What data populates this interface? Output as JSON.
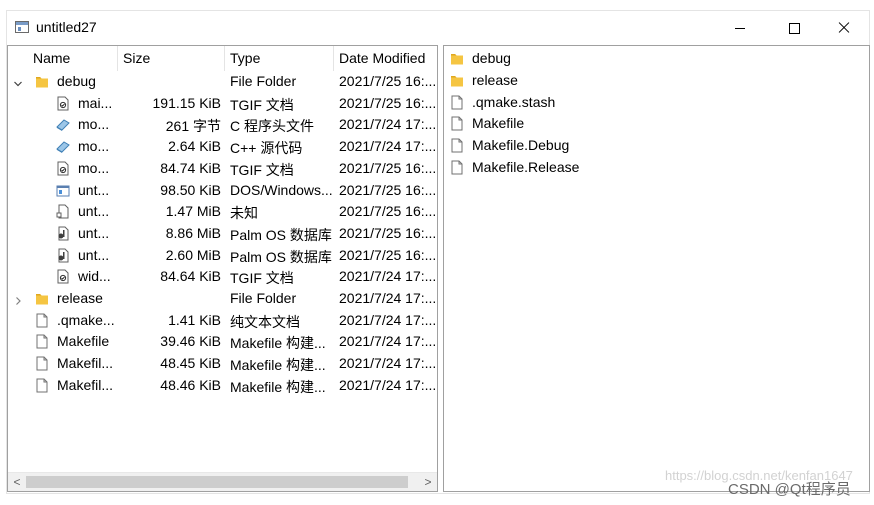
{
  "window": {
    "title": "untitled27"
  },
  "tree": {
    "columns": [
      "Name",
      "Size",
      "Type",
      "Date Modified"
    ],
    "rows": [
      {
        "name": "debug",
        "size": "",
        "type": "File Folder",
        "date": "2021/7/25 16:...",
        "kind": "folder",
        "depth": 0,
        "expander": "expanded",
        "icon": "folder-icon"
      },
      {
        "name": "mai...",
        "size": "191.15 KiB",
        "type": "TGIF 文档",
        "date": "2021/7/25 16:...",
        "kind": "file",
        "depth": 1,
        "icon": "tgif-file-icon"
      },
      {
        "name": "mo...",
        "size": "261 字节",
        "type": "C 程序头文件",
        "date": "2021/7/24 17:...",
        "kind": "file",
        "depth": 1,
        "icon": "source-file-icon"
      },
      {
        "name": "mo...",
        "size": "2.64 KiB",
        "type": "C++ 源代码",
        "date": "2021/7/24 17:...",
        "kind": "file",
        "depth": 1,
        "icon": "source-file-icon"
      },
      {
        "name": "mo...",
        "size": "84.74 KiB",
        "type": "TGIF 文档",
        "date": "2021/7/25 16:...",
        "kind": "file",
        "depth": 1,
        "icon": "tgif-file-icon"
      },
      {
        "name": "unt...",
        "size": "98.50 KiB",
        "type": "DOS/Windows...",
        "date": "2021/7/25 16:...",
        "kind": "file",
        "depth": 1,
        "icon": "executable-file-icon"
      },
      {
        "name": "unt...",
        "size": "1.47 MiB",
        "type": "未知",
        "date": "2021/7/25 16:...",
        "kind": "file",
        "depth": 1,
        "icon": "unknown-file-icon"
      },
      {
        "name": "unt...",
        "size": "8.86 MiB",
        "type": "Palm OS 数据库",
        "date": "2021/7/25 16:...",
        "kind": "file",
        "depth": 1,
        "icon": "database-file-icon"
      },
      {
        "name": "unt...",
        "size": "2.60 MiB",
        "type": "Palm OS 数据库",
        "date": "2021/7/25 16:...",
        "kind": "file",
        "depth": 1,
        "icon": "database-file-icon"
      },
      {
        "name": "wid...",
        "size": "84.64 KiB",
        "type": "TGIF 文档",
        "date": "2021/7/24 17:...",
        "kind": "file",
        "depth": 1,
        "icon": "tgif-file-icon"
      },
      {
        "name": "release",
        "size": "",
        "type": "File Folder",
        "date": "2021/7/24 17:...",
        "kind": "folder",
        "depth": 0,
        "expander": "collapsed",
        "icon": "folder-icon"
      },
      {
        "name": ".qmake...",
        "size": "1.41 KiB",
        "type": "纯文本文档",
        "date": "2021/7/24 17:...",
        "kind": "file",
        "depth": 0,
        "icon": "file-icon"
      },
      {
        "name": "Makefile",
        "size": "39.46 KiB",
        "type": "Makefile 构建...",
        "date": "2021/7/24 17:...",
        "kind": "file",
        "depth": 0,
        "icon": "file-icon"
      },
      {
        "name": "Makefil...",
        "size": "48.45 KiB",
        "type": "Makefile 构建...",
        "date": "2021/7/24 17:...",
        "kind": "file",
        "depth": 0,
        "icon": "file-icon"
      },
      {
        "name": "Makefil...",
        "size": "48.46 KiB",
        "type": "Makefile 构建...",
        "date": "2021/7/24 17:...",
        "kind": "file",
        "depth": 0,
        "icon": "file-icon"
      }
    ]
  },
  "list": {
    "items": [
      {
        "name": "debug",
        "kind": "folder",
        "icon": "folder-icon"
      },
      {
        "name": "release",
        "kind": "folder",
        "icon": "folder-icon"
      },
      {
        "name": ".qmake.stash",
        "kind": "file",
        "icon": "file-icon"
      },
      {
        "name": "Makefile",
        "kind": "file",
        "icon": "file-icon"
      },
      {
        "name": "Makefile.Debug",
        "kind": "file",
        "icon": "file-icon"
      },
      {
        "name": "Makefile.Release",
        "kind": "file",
        "icon": "file-icon"
      }
    ]
  },
  "scrollbar": {
    "left_arrow": "<",
    "right_arrow": ">"
  },
  "watermark": {
    "url": "https://blog.csdn.net/kenfan1647",
    "label": "CSDN @Qt程序员"
  },
  "colors": {
    "folder": "#f5c542",
    "folder_dark": "#e0a81f",
    "border": "#a0a0a0"
  }
}
